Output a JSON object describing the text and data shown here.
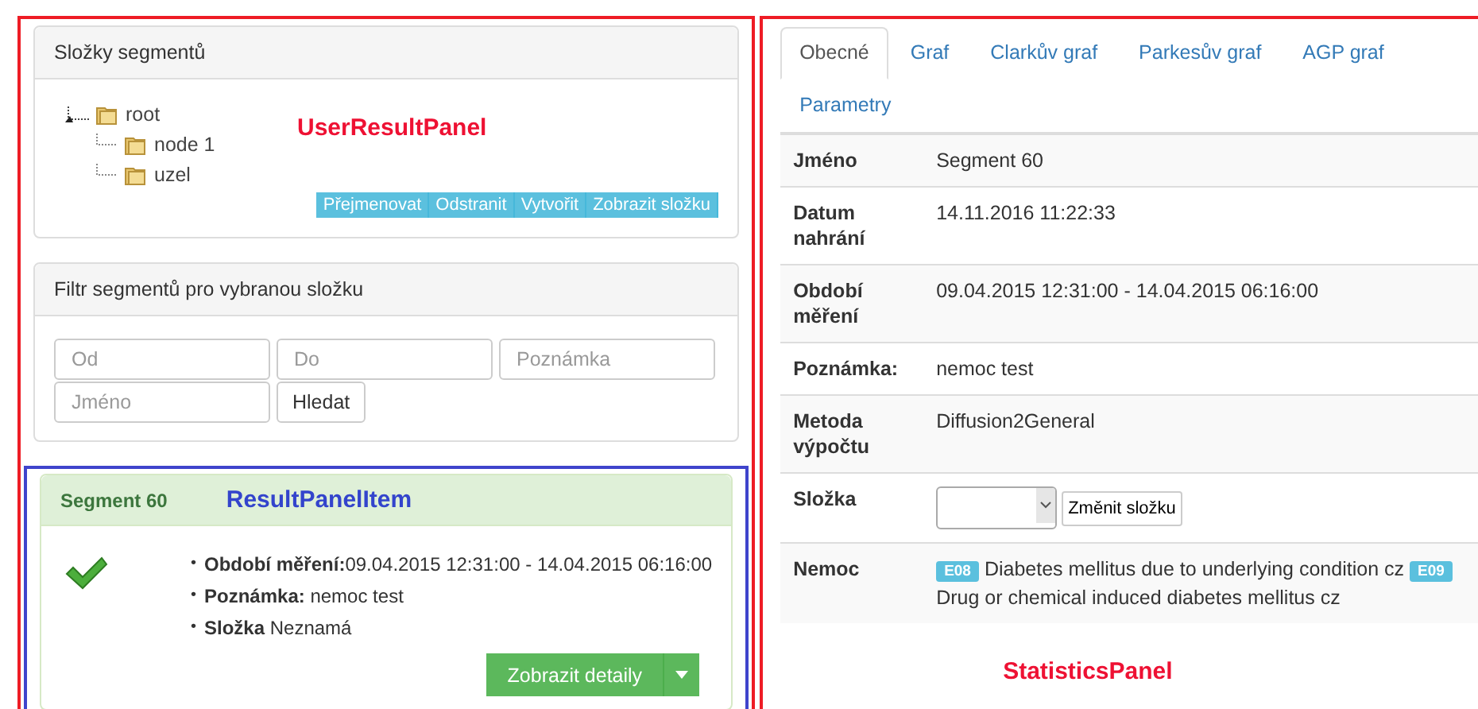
{
  "user_result_panel": {
    "annotation": "UserResultPanel",
    "folders_panel": {
      "title": "Složky segmentů",
      "tree": [
        {
          "label": "root",
          "children": [
            {
              "label": "node 1"
            },
            {
              "label": "uzel"
            }
          ]
        }
      ],
      "buttons": [
        "Přejmenovat",
        "Odstranit",
        "Vytvořit",
        "Zobrazit složku"
      ]
    },
    "filter_panel": {
      "title": "Filtr segmentů pro vybranou složku",
      "fields": [
        {
          "placeholder": "Od"
        },
        {
          "placeholder": "Do"
        },
        {
          "placeholder": "Poznámka"
        },
        {
          "placeholder": "Jméno"
        }
      ],
      "search_button": "Hledat"
    },
    "result_item": {
      "annotation": "ResultPanelItem",
      "title": "Segment 60",
      "details": [
        {
          "bullet": "•",
          "text": "**Období měření:**09.04.2015 12:31:00 - 14.04.2015 06:16:00"
        },
        {
          "bullet": "•",
          "text": "**Poznámka:** nemoc test"
        },
        {
          "bullet": "•",
          "text": "**Složka** Neznamá"
        }
      ],
      "button": "Zobrazit detaily"
    }
  },
  "statistics_panel": {
    "annotation": "StatisticsPanel",
    "tabs": [
      {
        "label": "Obecné",
        "selected": true
      },
      {
        "label": "Graf",
        "selected": false
      },
      {
        "label": "Clarkův graf",
        "selected": false
      },
      {
        "label": "Parkesův graf",
        "selected": false
      },
      {
        "label": "AGP graf",
        "selected": false
      },
      {
        "label": "Parametry",
        "selected": false
      }
    ],
    "rows": [
      {
        "kind": "text",
        "label": "Jméno",
        "value": "Segment 60"
      },
      {
        "kind": "text",
        "label": "Datum nahrání",
        "value": "14.11.2016 11:22:33"
      },
      {
        "kind": "text",
        "label": "Období měření",
        "value": "09.04.2015 12:31:00 - 14.04.2015 06:16:00"
      },
      {
        "kind": "text",
        "label": "Poznámka:",
        "value": "nemoc test"
      },
      {
        "kind": "text",
        "label": "Metoda výpočtu",
        "value": "Diffusion2General"
      },
      {
        "kind": "select",
        "label": "Složka",
        "button": "Změnit složku"
      },
      {
        "kind": "tags",
        "label": "Nemoc",
        "items": [
          {
            "code": "E08",
            "text": "Diabetes mellitus due to underlying condition cz"
          },
          {
            "code": "E09",
            "text": "Drug or chemical induced diabetes mellitus cz"
          }
        ]
      }
    ]
  }
}
